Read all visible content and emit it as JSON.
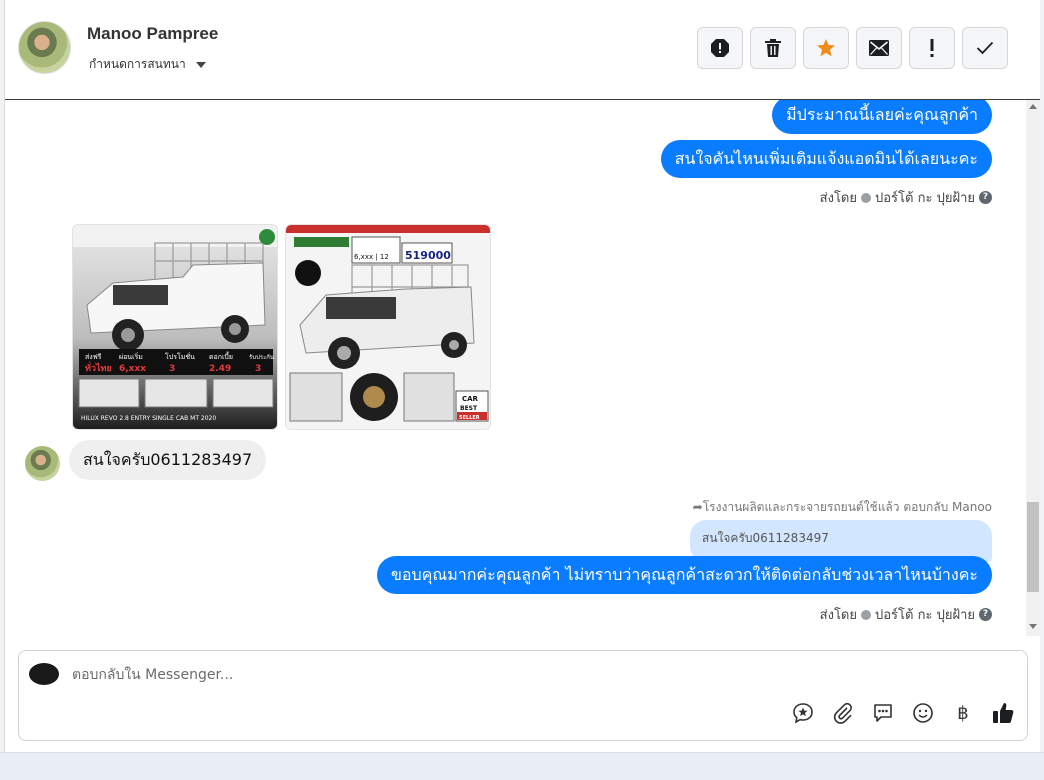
{
  "header": {
    "contact_name": "Manoo Pampree",
    "assign_label": "กำหนดการสนทนา",
    "toolbar": [
      {
        "name": "spam-button",
        "icon": "alert-octagon-icon"
      },
      {
        "name": "delete-button",
        "icon": "trash-icon"
      },
      {
        "name": "star-button",
        "icon": "star-icon",
        "color": "#f28b1c"
      },
      {
        "name": "mark-unread-button",
        "icon": "envelope-icon"
      },
      {
        "name": "follow-up-button",
        "icon": "exclamation-icon"
      },
      {
        "name": "done-button",
        "icon": "check-icon"
      }
    ]
  },
  "messages": {
    "out1": "มีประมาณนี้เลยค่ะคุณลูกค้า",
    "out2": "สนใจคันไหนเพิ่มเติมแจ้งแอดมินได้เลยนะคะ",
    "sent_by_1": "ส่งโดย",
    "sender_1": "ปอร์โต้ กะ ปุยฝ้าย",
    "images": [
      {
        "title": "HILUX REVO 2.8 ENTRY SINGLE CAB MT 2020",
        "tag1": "ส่งฟรี",
        "tag2": "ทั่วไทย",
        "tag3": "ผ่อนเริ่ม",
        "tag4": "6,xxx",
        "tag5": "โปรโมชั่น",
        "tag6": "3",
        "tag7": "ดอกเบี้ย",
        "tag8": "2.49",
        "tag9": "รับประกัน",
        "tag10": "3"
      },
      {
        "price": "519000",
        "label": "6,xxx | 12",
        "brand1": "CAR",
        "brand2": "BEST",
        "brand3": "SELLER"
      }
    ],
    "in1": "สนใจครับ0611283497",
    "reply_note": "โรงงานผลิตและกระจายรถยนต์ใช้แล้ว ตอบกลับ Manoo",
    "quoted": "สนใจครับ0611283497",
    "out3": "ขอบคุณมากค่ะคุณลูกค้า ไม่ทราบว่าคุณลูกค้าสะดวกให้ติดต่อกลับช่วงเวลาไหนบ้างคะ",
    "sent_by_2": "ส่งโดย",
    "sender_2": "ปอร์โต้ กะ ปุยฝ้าย"
  },
  "composer": {
    "placeholder": "ตอบกลับใน Messenger...",
    "currency_symbol": "฿"
  },
  "colors": {
    "brand_blue": "#0a7cff",
    "incoming_bg": "#efefef",
    "quoted_bg": "#d3e6ff",
    "star": "#f28b1c"
  }
}
